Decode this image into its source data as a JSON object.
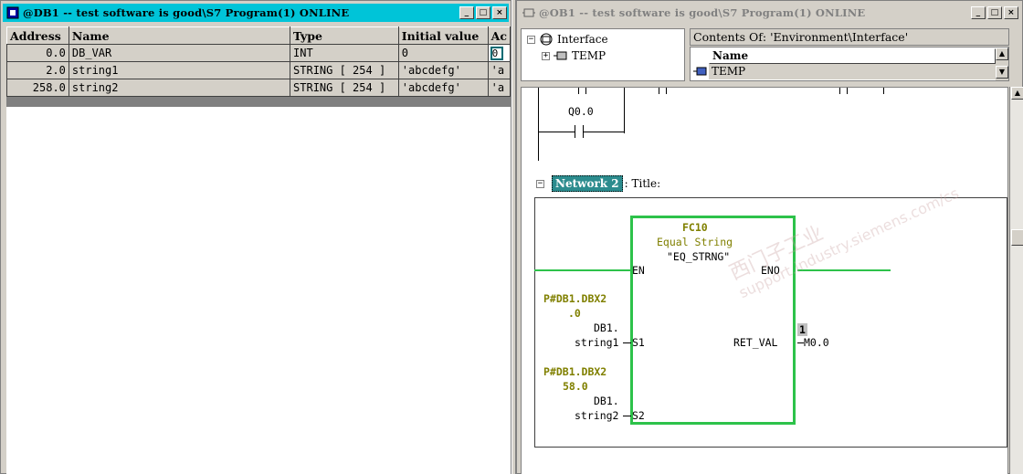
{
  "left_window": {
    "title": "@DB1 -- test software is good\\S7 Program(1)  ONLINE",
    "buttons": {
      "minimize": "_",
      "maximize": "□",
      "close": "×"
    },
    "table": {
      "headers": [
        "Address",
        "Name",
        "Type",
        "Initial value",
        "Ac"
      ],
      "rows": [
        {
          "address": "0.0",
          "name": "DB_VAR",
          "type": "INT",
          "initial": "0",
          "actual": "0"
        },
        {
          "address": "2.0",
          "name": "string1",
          "type": "STRING [ 254 ]",
          "initial": "'abcdefg'",
          "actual": "'a"
        },
        {
          "address": "258.0",
          "name": "string2",
          "type": "STRING [ 254 ]",
          "initial": "'abcdefg'",
          "actual": "'a"
        }
      ]
    }
  },
  "right_window": {
    "title": "@OB1 -- test software is good\\S7 Program(1)  ONLINE",
    "buttons": {
      "minimize": "_",
      "maximize": "□",
      "close": "×"
    },
    "interface_tree": {
      "root": "Interface",
      "child": "TEMP"
    },
    "contents": {
      "header": "Contents Of: 'Environment\\Interface'",
      "column": "Name",
      "row": "TEMP"
    },
    "ladder": {
      "contact_label": "Q0.0",
      "network_tag": "Network 2",
      "network_title": ": Title:",
      "block_name": "FC10",
      "block_desc": "Equal String",
      "block_symbol": "\"EQ_STRNG\"",
      "pin_en": "EN",
      "pin_eno": "ENO",
      "pin_s1": "S1",
      "pin_s2": "S2",
      "pin_ret": "RET_VAL",
      "s1_ptr_1": "P#DB1.DBX2",
      "s1_ptr_2": ".0",
      "s1_db": "DB1.",
      "s1_var": "string1",
      "s2_ptr_1": "P#DB1.DBX2",
      "s2_ptr_2": "58.0",
      "s2_db": "DB1.",
      "s2_var": "string2",
      "ret_value": "1",
      "ret_out": "M0.0"
    },
    "watermark": [
      "西门子工业",
      "support.industry.siemens.com/cs"
    ]
  },
  "colors": {
    "active_title": "#00c4d8",
    "box_green": "#2dc24a",
    "olive": "#808000",
    "network_tag": "#2c8c8e"
  }
}
